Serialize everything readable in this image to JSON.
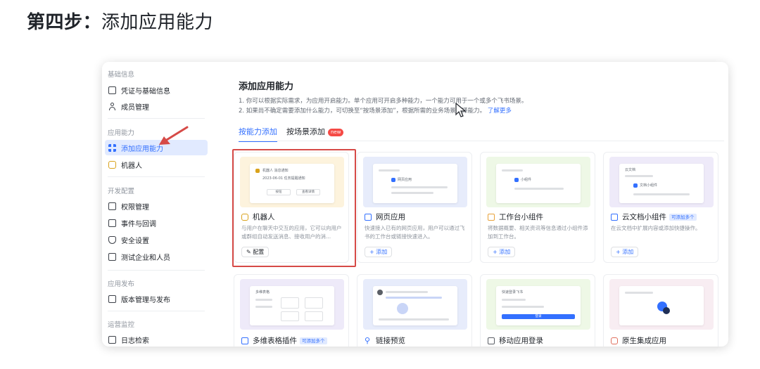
{
  "heading": {
    "strong": "第四步：",
    "rest": "添加应用能力"
  },
  "sidebar": {
    "groups": [
      {
        "label": "基础信息"
      },
      {
        "label": "应用能力"
      },
      {
        "label": "开发配置"
      },
      {
        "label": "应用发布"
      },
      {
        "label": "运营监控"
      }
    ],
    "items": [
      {
        "label": "凭证与基础信息",
        "icon": "id-card-icon"
      },
      {
        "label": "成员管理",
        "icon": "person-icon"
      },
      {
        "label": "添加应用能力",
        "icon": "grid-icon",
        "active": true
      },
      {
        "label": "机器人",
        "icon": "robot-icon"
      },
      {
        "label": "权限管理",
        "icon": "lock-icon"
      },
      {
        "label": "事件与回调",
        "icon": "event-icon"
      },
      {
        "label": "安全设置",
        "icon": "shield-icon"
      },
      {
        "label": "测试企业和人员",
        "icon": "test-icon"
      },
      {
        "label": "版本管理与发布",
        "icon": "upload-icon"
      },
      {
        "label": "日志检索",
        "icon": "log-icon"
      }
    ]
  },
  "main": {
    "title": "添加应用能力",
    "desc1": "1. 你可以根据实际需求，为应用开启能力。单个应用可开启多种能力，一个能力可用于一个或多个飞书场景。",
    "desc2": "2. 如果尚不确定需要添加什么能力，可切换至“按场景添加”，根据所需的业务场景选择能力。",
    "learn_more": "了解更多",
    "tabs": [
      {
        "label": "按能力添加",
        "active": true
      },
      {
        "label": "按场景添加",
        "badge": "new"
      }
    ]
  },
  "cards": [
    {
      "title": "机器人",
      "icon": "robot-icon",
      "desc": "与用户在聊天中交互的应用，它可以向用户或群组自动发送消息、接收用户的消...",
      "action": "配置",
      "preview_text_1": "机器人 消息通知",
      "preview_text_2": "2023-06-01 任务提醒通知",
      "preview_btn_1": "按钮",
      "preview_btn_2": "查看详情"
    },
    {
      "title": "网页应用",
      "icon": "web-app-icon",
      "desc": "快速接入已有的网页应用，用户可以通过飞书的工作台或链接快速进入。",
      "action": "+ 添加",
      "preview_text": "网页应用"
    },
    {
      "title": "工作台小组件",
      "icon": "widget-icon",
      "desc": "将数据概要、相关资讯等信息通过小组件添加到工作台。",
      "action": "+ 添加",
      "preview_text": "小组件"
    },
    {
      "title": "云文档小组件",
      "icon": "doc-widget-icon",
      "tag": "可添加多个",
      "desc": "在云文档中扩展内容或添加快捷操作。",
      "action": "+ 添加",
      "preview_text": "云文档",
      "preview_row": "文档小组件"
    },
    {
      "title": "多维表格插件",
      "icon": "table-plugin-icon",
      "tag": "可添加多个",
      "preview_text": "多维表格"
    },
    {
      "title": "链接预览",
      "icon": "link-icon"
    },
    {
      "title": "移动应用登录",
      "icon": "mobile-login-icon",
      "preview_text": "快速登录飞书",
      "preview_btn": "登录"
    },
    {
      "title": "原生集成应用",
      "icon": "native-app-icon"
    }
  ],
  "colors": {
    "accent": "#3370ff",
    "highlight": "#d64a47",
    "new_badge": "#f54a45"
  }
}
